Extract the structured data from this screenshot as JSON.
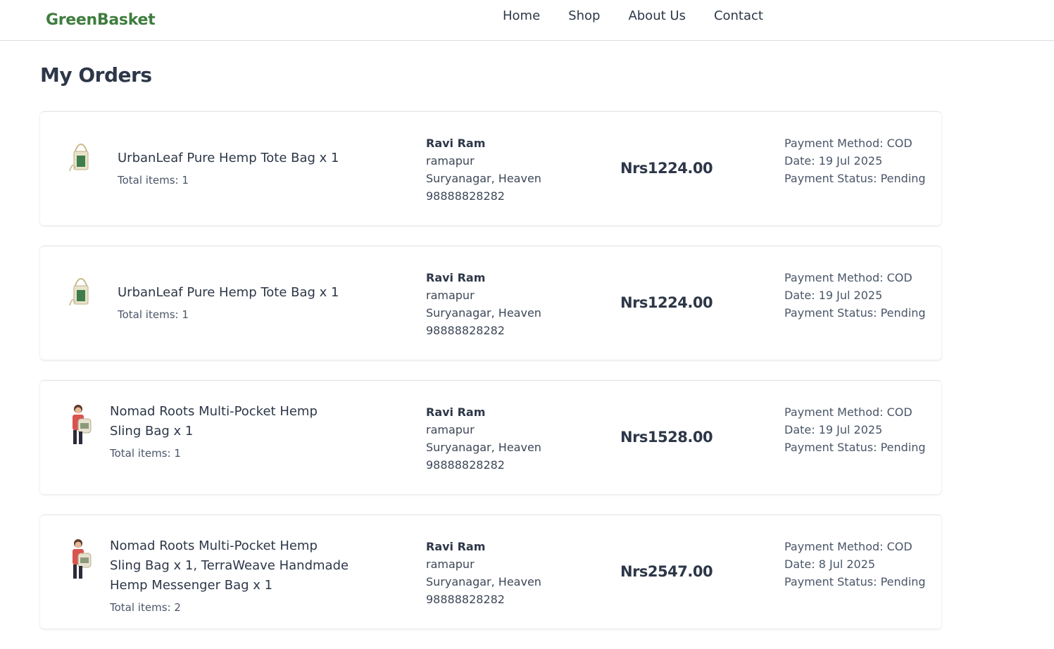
{
  "brand": "GreenBasket",
  "nav": [
    "Home",
    "Shop",
    "About Us",
    "Contact"
  ],
  "page_title": "My Orders",
  "orders": [
    {
      "product": "UrbanLeaf Pure Hemp Tote Bag x 1",
      "total_items": "Total items: 1",
      "thumb": "tote-bag",
      "customer_name": "Ravi Ram",
      "address_line1": "ramapur",
      "address_line2": "Suryanagar, Heaven",
      "phone": "98888828282",
      "amount": "Nrs1224.00",
      "payment_method": "Payment Method: COD",
      "date": "Date: 19 Jul 2025",
      "payment_status": "Payment Status: Pending"
    },
    {
      "product": "UrbanLeaf Pure Hemp Tote Bag x 1",
      "total_items": "Total items: 1",
      "thumb": "tote-bag",
      "customer_name": "Ravi Ram",
      "address_line1": "ramapur",
      "address_line2": "Suryanagar, Heaven",
      "phone": "98888828282",
      "amount": "Nrs1224.00",
      "payment_method": "Payment Method: COD",
      "date": "Date: 19 Jul 2025",
      "payment_status": "Payment Status: Pending"
    },
    {
      "product": "Nomad Roots Multi-Pocket Hemp Sling Bag x 1",
      "total_items": "Total items: 1",
      "thumb": "sling-bag",
      "customer_name": "Ravi Ram",
      "address_line1": "ramapur",
      "address_line2": "Suryanagar, Heaven",
      "phone": "98888828282",
      "amount": "Nrs1528.00",
      "payment_method": "Payment Method: COD",
      "date": "Date: 19 Jul 2025",
      "payment_status": "Payment Status: Pending"
    },
    {
      "product": "Nomad Roots Multi-Pocket Hemp Sling Bag x 1, TerraWeave Handmade Hemp Messenger Bag x 1",
      "total_items": "Total items: 2",
      "thumb": "sling-bag",
      "customer_name": "Ravi Ram",
      "address_line1": "ramapur",
      "address_line2": "Suryanagar, Heaven",
      "phone": "98888828282",
      "amount": "Nrs2547.00",
      "payment_method": "Payment Method: COD",
      "date": "Date: 8 Jul 2025",
      "payment_status": "Payment Status: Pending"
    }
  ]
}
